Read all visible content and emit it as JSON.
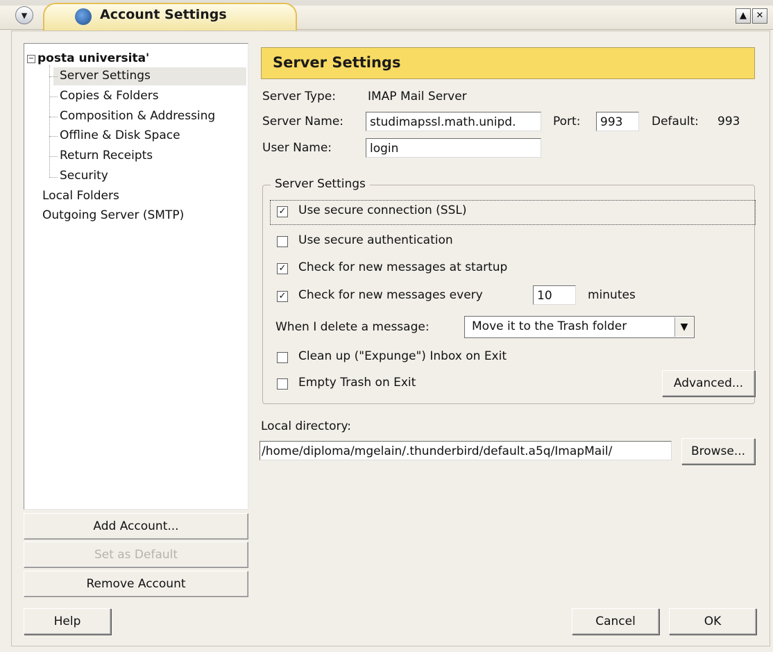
{
  "window": {
    "title": "Account Settings"
  },
  "tree": {
    "root": "posta universita'",
    "children": [
      "Server Settings",
      "Copies & Folders",
      "Composition & Addressing",
      "Offline & Disk Space",
      "Return Receipts",
      "Security"
    ],
    "others": [
      "Local Folders",
      "Outgoing Server (SMTP)"
    ]
  },
  "left_buttons": {
    "add_account": "Add Account...",
    "set_default": "Set as Default",
    "remove_account": "Remove Account"
  },
  "main": {
    "header": "Server Settings",
    "server_type_label": "Server Type:",
    "server_type_value": "IMAP Mail Server",
    "server_name_label": "Server Name:",
    "server_name_value": "studimapssl.math.unipd.",
    "port_label": "Port:",
    "port_value": "993",
    "default_label": "Default:",
    "default_value": "993",
    "user_name_label": "User Name:",
    "user_name_value": "login",
    "group_title": "Server Settings",
    "checks": [
      {
        "label": "Use secure connection (SSL)",
        "checked": true
      },
      {
        "label": "Use secure authentication",
        "checked": false
      },
      {
        "label": "Check for new messages at startup",
        "checked": true
      },
      {
        "label": "Check for new messages every",
        "checked": true
      },
      {
        "label": "Clean up (\"Expunge\") Inbox on Exit",
        "checked": false
      },
      {
        "label": "Empty Trash on Exit",
        "checked": false
      }
    ],
    "interval_value": "10",
    "interval_unit": "minutes",
    "delete_label": "When I delete a message:",
    "delete_option": "Move it to the Trash folder",
    "advanced_button": "Advanced...",
    "local_dir_label": "Local directory:",
    "local_dir_value": "/home/diploma/mgelain/.thunderbird/default.a5q/ImapMail/",
    "browse_button": "Browse..."
  },
  "footer": {
    "help": "Help",
    "cancel": "Cancel",
    "ok": "OK"
  },
  "icons": {
    "menu": "chevron-down-icon",
    "app": "thunderbird-icon",
    "maximize": "maximize-icon",
    "close": "close-icon"
  }
}
